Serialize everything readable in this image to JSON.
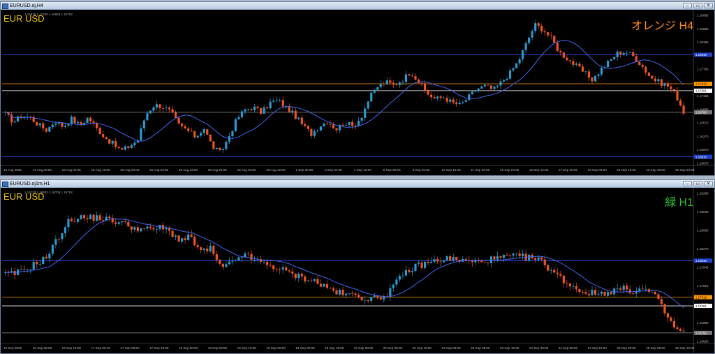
{
  "windows": [
    {
      "title": "EURUSD.oj,H4",
      "symbol_label": "EUR USD",
      "ohlc_text": "1.16979 1.17100 1.16683 1.16792",
      "tag": "オレンジ H4",
      "tag_color": "#ff8c1a",
      "chart_data": {
        "type": "candlestick",
        "price_range": [
          1.15645,
          1.18965
        ],
        "price_ticks": [
          "1.18965",
          "1.18665",
          "1.18365",
          "1.18065",
          "1.17765",
          "1.17465",
          "1.17165",
          "1.16865",
          "1.16570",
          "1.16270",
          "1.15970",
          "1.15675"
        ],
        "time_labels": [
          "13 Aug 2025",
          "14 Aug 20:00",
          "18 Aug 04:00",
          "19 Aug 12:00",
          "20 Aug 20:00",
          "22 Aug 04:00",
          "25 Aug 12:00",
          "26 Aug 20:00",
          "28 Aug 04:00",
          "29 Aug 12:00",
          "1 Sep 20:00",
          "3 Sep 04:00",
          "4 Sep 12:00",
          "5 Sep 20:00",
          "9 Sep 04:00",
          "10 Sep 12:00",
          "11 Sep 20:00",
          "15 Sep 04:00",
          "16 Sep 12:00",
          "17 Sep 20:00",
          "19 Sep 04:00",
          "22 Sep 12:00",
          "23 Sep 20:00",
          "25 Sep 04:00"
        ],
        "hlines": [
          {
            "price": 1.18045,
            "color": "#3355ff",
            "label": "1.18045"
          },
          {
            "price": 1.17412,
            "color": "#ff9900",
            "label": "1.17412"
          },
          {
            "price": 1.17261,
            "color": "#ffffff",
            "label": "1.17261"
          },
          {
            "price": 1.16792,
            "color": "#888888",
            "label": "1.16792"
          },
          {
            "price": 1.15818,
            "color": "#3355ff",
            "label": "1.15818"
          }
        ],
        "close_path": [
          1.1675,
          1.1658,
          1.1672,
          1.1668,
          1.1652,
          1.164,
          1.166,
          1.1648,
          1.1665,
          1.165,
          1.1668,
          1.1645,
          1.1625,
          1.161,
          1.1595,
          1.1605,
          1.1618,
          1.1675,
          1.1695,
          1.1692,
          1.168,
          1.165,
          1.164,
          1.1625,
          1.1645,
          1.1605,
          1.159,
          1.1625,
          1.1665,
          1.1685,
          1.169,
          1.1678,
          1.17,
          1.1705,
          1.1688,
          1.1672,
          1.165,
          1.1632,
          1.165,
          1.166,
          1.1642,
          1.1658,
          1.1648,
          1.1668,
          1.171,
          1.1735,
          1.1745,
          1.1738,
          1.175,
          1.1768,
          1.1745,
          1.172,
          1.1708,
          1.1712,
          1.17,
          1.1695,
          1.1712,
          1.173,
          1.1736,
          1.1728,
          1.1745,
          1.1765,
          1.179,
          1.183,
          1.187,
          1.186,
          1.184,
          1.181,
          1.1795,
          1.178,
          1.1765,
          1.175,
          1.1772,
          1.179,
          1.1808,
          1.1812,
          1.18,
          1.178,
          1.1755,
          1.1745,
          1.1738,
          1.172,
          1.168
        ],
        "ma_color": "#4466ee",
        "up_color": "#2a9ad0",
        "down_color": "#ee5522"
      }
    },
    {
      "title": "EURUSD.oj1m,H1",
      "symbol_label": "EUR USD",
      "ohlc_text": "1.16720 1.16832 1.16706 1.16792",
      "tag": "緑 H1",
      "tag_color": "#2fc42f",
      "chart_data": {
        "type": "candlestick",
        "price_range": [
          1.1662,
          1.1926
        ],
        "price_ticks": [
          "1.19260",
          "1.18930",
          "1.18600",
          "1.18270",
          "1.17945",
          "1.17615",
          "1.17285",
          "1.16955",
          "1.16620"
        ],
        "time_labels": [
          "16 Sep 2025",
          "16 Sep 08:00",
          "16 Sep 16:00",
          "17 Sep 00:00",
          "17 Sep 08:00",
          "17 Sep 16:00",
          "18 Sep 00:00",
          "18 Sep 08:00",
          "18 Sep 16:00",
          "19 Sep 00:00",
          "19 Sep 08:00",
          "19 Sep 16:00",
          "22 Sep 00:00",
          "22 Sep 08:00",
          "22 Sep 16:00",
          "23 Sep 00:00",
          "23 Sep 08:00",
          "23 Sep 16:00",
          "24 Sep 00:00",
          "24 Sep 08:00",
          "24 Sep 16:00",
          "25 Sep 00:00",
          "25 Sep 08:00",
          "25 Sep 16:00"
        ],
        "hlines": [
          {
            "price": 1.18045,
            "color": "#3355ff",
            "label": "1.18045"
          },
          {
            "price": 1.17412,
            "color": "#ff9900",
            "label": "1.17412"
          },
          {
            "price": 1.17261,
            "color": "#ffffff",
            "label": "1.17261"
          },
          {
            "price": 1.16792,
            "color": "#888888",
            "label": "1.16792"
          }
        ],
        "close_path": [
          1.178,
          1.1782,
          1.179,
          1.18,
          1.181,
          1.184,
          1.187,
          1.188,
          1.1878,
          1.188,
          1.1875,
          1.1872,
          1.1865,
          1.186,
          1.1858,
          1.1862,
          1.1855,
          1.184,
          1.1845,
          1.182,
          1.1825,
          1.179,
          1.18,
          1.1815,
          1.1808,
          1.18,
          1.1795,
          1.1788,
          1.178,
          1.1775,
          1.177,
          1.176,
          1.1752,
          1.1745,
          1.1745,
          1.174,
          1.1738,
          1.1745,
          1.1765,
          1.1785,
          1.1795,
          1.18,
          1.1805,
          1.1808,
          1.1806,
          1.1803,
          1.1802,
          1.1806,
          1.1808,
          1.1812,
          1.1811,
          1.181,
          1.1805,
          1.179,
          1.1775,
          1.1762,
          1.1752,
          1.1748,
          1.1748,
          1.1752,
          1.1756,
          1.1752,
          1.1755,
          1.1748,
          1.172,
          1.169,
          1.1679
        ],
        "ma_color": "#4466ee",
        "up_color": "#2a9ad0",
        "down_color": "#ee5522"
      }
    }
  ]
}
